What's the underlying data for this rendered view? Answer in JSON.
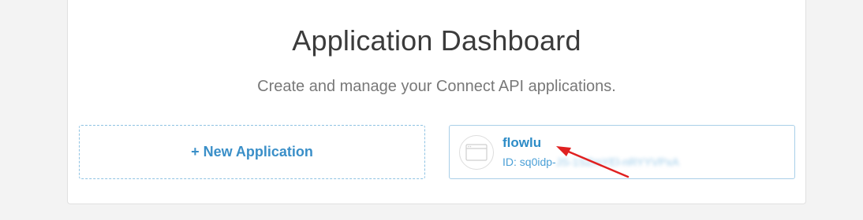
{
  "dashboard": {
    "title": "Application Dashboard",
    "subtitle": "Create and manage your Connect API applications."
  },
  "new_application": {
    "label": "+ New Application"
  },
  "applications": [
    {
      "name": "flowlu",
      "id_prefix": "ID: sq0idp-",
      "id_redacted": "JS-1SZmYEl-nRYYVPxA"
    }
  ],
  "colors": {
    "accent": "#2d8cc7",
    "annotation_arrow": "#e02020"
  }
}
